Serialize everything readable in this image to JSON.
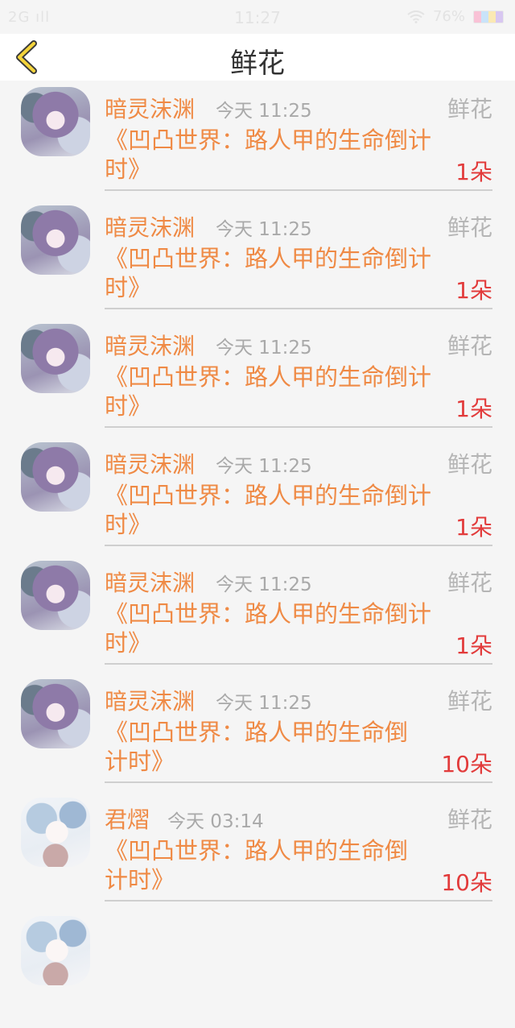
{
  "status_bar": {
    "network": "2G ıll",
    "time": "11:27",
    "wifi_icon": "wifi-icon",
    "battery_text": "76%"
  },
  "nav": {
    "title": "鲜花",
    "back_icon": "chevron-left-icon"
  },
  "items": [
    {
      "name": "暗灵沫渊",
      "time": "今天 11:25",
      "type": "鲜花",
      "book_line1": "《凹凸世界：路人甲的生命倒计",
      "book_line2": "时》",
      "count": "1朵",
      "avatar": "a1"
    },
    {
      "name": "暗灵沫渊",
      "time": "今天 11:25",
      "type": "鲜花",
      "book_line1": "《凹凸世界：路人甲的生命倒计",
      "book_line2": "时》",
      "count": "1朵",
      "avatar": "a1"
    },
    {
      "name": "暗灵沫渊",
      "time": "今天 11:25",
      "type": "鲜花",
      "book_line1": "《凹凸世界：路人甲的生命倒计",
      "book_line2": "时》",
      "count": "1朵",
      "avatar": "a1"
    },
    {
      "name": "暗灵沫渊",
      "time": "今天 11:25",
      "type": "鲜花",
      "book_line1": "《凹凸世界：路人甲的生命倒计",
      "book_line2": "时》",
      "count": "1朵",
      "avatar": "a1"
    },
    {
      "name": "暗灵沫渊",
      "time": "今天 11:25",
      "type": "鲜花",
      "book_line1": "《凹凸世界：路人甲的生命倒计",
      "book_line2": "时》",
      "count": "1朵",
      "avatar": "a1"
    },
    {
      "name": "暗灵沫渊",
      "time": "今天 11:25",
      "type": "鲜花",
      "book_line1": "《凹凸世界：路人甲的生命倒",
      "book_line2": "计时》",
      "count": "10朵",
      "avatar": "a1"
    },
    {
      "name": "君熠",
      "time": "今天 03:14",
      "type": "鲜花",
      "book_line1": "《凹凸世界：路人甲的生命倒",
      "book_line2": "计时》",
      "count": "10朵",
      "avatar": "a2"
    }
  ]
}
